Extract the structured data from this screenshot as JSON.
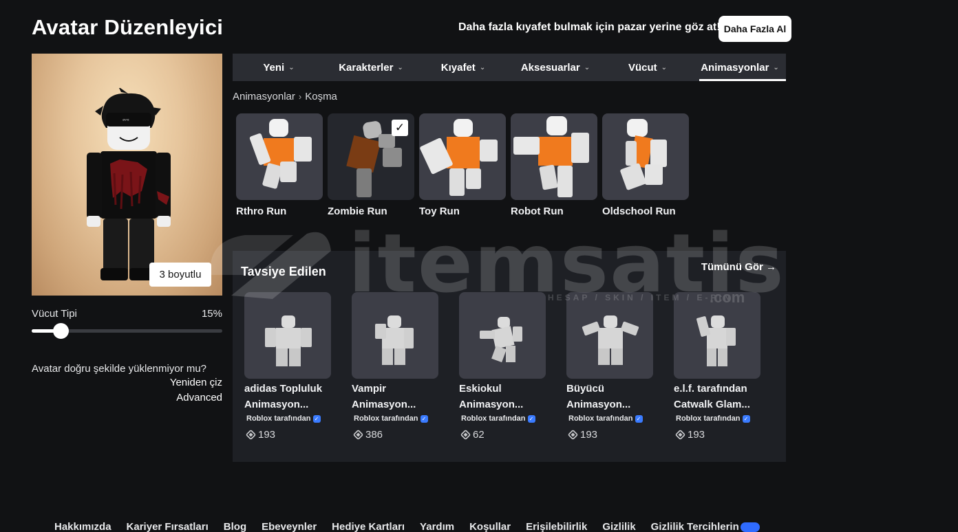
{
  "header": {
    "title": "Avatar Düzenleyici",
    "promo_text": "Daha fazla kıyafet bulmak için pazar yerine göz at!",
    "promo_button": "Daha Fazla Al"
  },
  "preview": {
    "view_3d_button": "3 boyutlu",
    "body_type_label": "Vücut Tipi",
    "body_type_value": "15%",
    "body_type_fraction": 0.15,
    "load_help": "Avatar doğru şekilde yüklenmiyor mu?",
    "redraw_link": "Yeniden çiz",
    "advanced_link": "Advanced"
  },
  "tabs": [
    {
      "label": "Yeni"
    },
    {
      "label": "Karakterler"
    },
    {
      "label": "Kıyafet"
    },
    {
      "label": "Aksesuarlar"
    },
    {
      "label": "Vücut"
    },
    {
      "label": "Animasyonlar"
    }
  ],
  "breadcrumb": {
    "parent": "Animasyonlar",
    "current": "Koşma"
  },
  "items": [
    {
      "name": "Rthro Run",
      "equipped": false
    },
    {
      "name": "Zombie Run",
      "equipped": true
    },
    {
      "name": "Toy Run",
      "equipped": false
    },
    {
      "name": "Robot Run",
      "equipped": false
    },
    {
      "name": "Oldschool Run",
      "equipped": false
    }
  ],
  "recommended": {
    "title": "Tavsiye Edilen",
    "see_all": "Tümünü Gör →",
    "items": [
      {
        "name": "adidas Topluluk\nAnimasyon...",
        "creator": "Roblox tarafından",
        "price": "193"
      },
      {
        "name": "Vampir\nAnimasyon...",
        "creator": "Roblox tarafından",
        "price": "386"
      },
      {
        "name": "Eskiokul\nAnimasyon...",
        "creator": "Roblox tarafından",
        "price": "62"
      },
      {
        "name": "Büyücü\nAnimasyon...",
        "creator": "Roblox tarafından",
        "price": "193"
      },
      {
        "name": "e.l.f. tarafından\nCatwalk Glam...",
        "creator": "Roblox tarafından",
        "price": "193"
      }
    ]
  },
  "watermark": {
    "brand": "itemsatis",
    "tagline": "HESAP / SKIN / ITEM / E-PIN",
    "domain": ".com"
  },
  "footer": [
    "Hakkımızda",
    "Kariyer Fırsatları",
    "Blog",
    "Ebeveynler",
    "Hediye Kartları",
    "Yardım",
    "Koşullar",
    "Erişilebilirlik",
    "Gizlilik",
    "Gizlilik Tercihlerin"
  ]
}
